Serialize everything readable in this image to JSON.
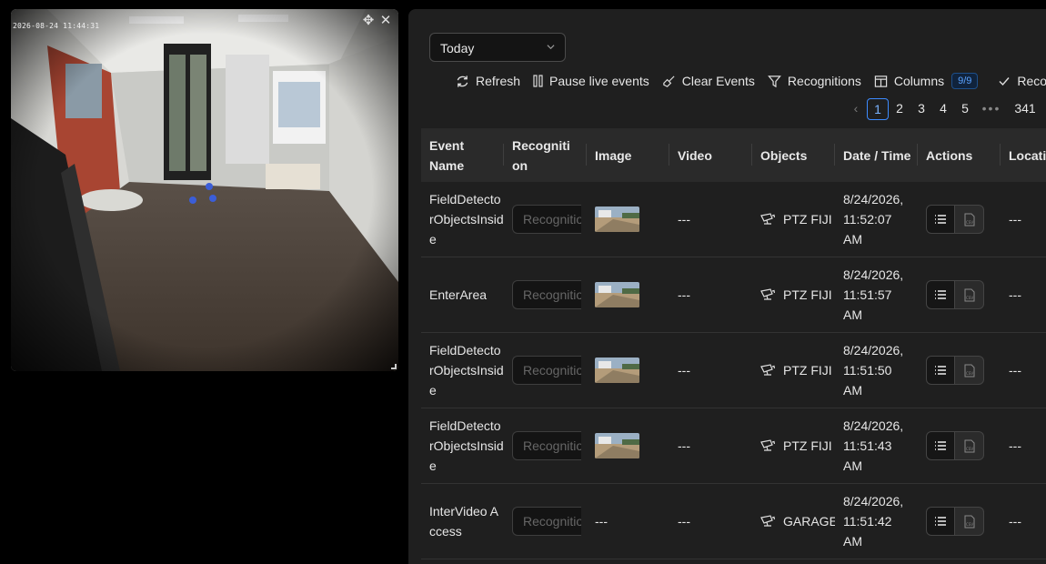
{
  "camera": {
    "timestamp": "2026-08-24 11:44:31",
    "move_icon": "move-icon",
    "close_icon": "close-icon"
  },
  "filter": {
    "selected": "Today"
  },
  "toolbar": {
    "refresh": "Refresh",
    "pause": "Pause live events",
    "clear": "Clear Events",
    "recognitions": "Recognitions",
    "columns": "Columns",
    "columns_badge": "9/9",
    "recog_truncated": "Recog"
  },
  "pager": {
    "pages": [
      "1",
      "2",
      "3",
      "4",
      "5"
    ],
    "last": "341",
    "current": "1"
  },
  "table": {
    "headers": [
      "Event Name",
      "Recognition",
      "Image",
      "Video",
      "Objects",
      "Date / Time",
      "Actions",
      "Location"
    ],
    "recognition_placeholder": "Recognition",
    "rows": [
      {
        "event": "FieldDetectorObjectsInside",
        "image": true,
        "image_text": "",
        "video": "---",
        "object": "PTZ FIJI",
        "date": "8/24/2026,",
        "time": "11:52:07",
        "ampm": "AM",
        "location": "---"
      },
      {
        "event": "EnterArea",
        "image": true,
        "image_text": "",
        "video": "---",
        "object": "PTZ FIJI",
        "date": "8/24/2026,",
        "time": "11:51:57",
        "ampm": "AM",
        "location": "---"
      },
      {
        "event": "FieldDetectorObjectsInside",
        "image": true,
        "image_text": "",
        "video": "---",
        "object": "PTZ FIJI",
        "date": "8/24/2026,",
        "time": "11:51:50",
        "ampm": "AM",
        "location": "---"
      },
      {
        "event": "FieldDetectorObjectsInside",
        "image": true,
        "image_text": "",
        "video": "---",
        "object": "PTZ FIJI",
        "date": "8/24/2026,",
        "time": "11:51:43",
        "ampm": "AM",
        "location": "---"
      },
      {
        "event": "InterVideo Access",
        "image": false,
        "image_text": "---",
        "video": "---",
        "object": "GARAGE",
        "date": "8/24/2026,",
        "time": "11:51:42",
        "ampm": "AM",
        "location": "---"
      }
    ]
  },
  "colors": {
    "accent": "#3d8bff",
    "panel": "#1f1f1f",
    "header": "#2a2a2a"
  }
}
